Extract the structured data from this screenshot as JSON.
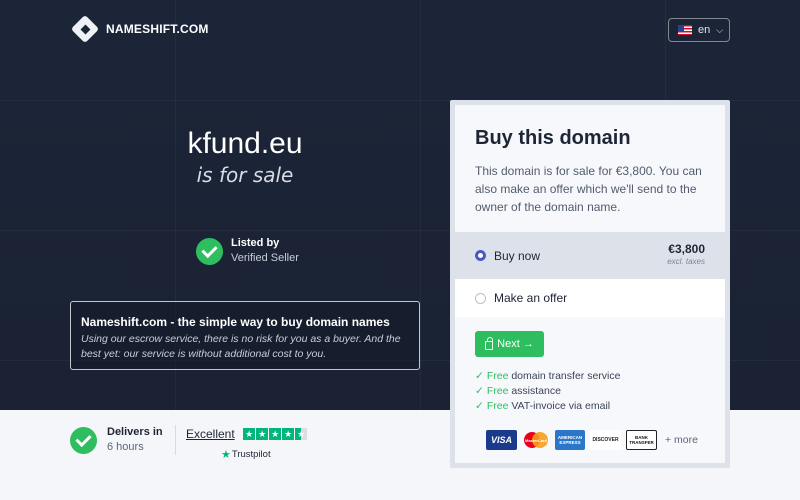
{
  "brand": {
    "name": "NAMESHIFT.COM"
  },
  "language": {
    "code": "en",
    "flag_icon": "us-flag-icon"
  },
  "hero": {
    "domain": "kfund.eu",
    "tagline": "is for sale",
    "seller_label": "Listed by",
    "seller_value": "Verified Seller"
  },
  "info": {
    "title": "Nameshift.com - the simple way to buy domain names",
    "body": "Using our escrow service, there is no risk for you as a buyer. And the best yet: our service is without additional cost to you."
  },
  "delivery": {
    "label": "Delivers in",
    "value": "6 hours"
  },
  "trustpilot": {
    "rating_label": "Excellent",
    "stars": 4.5,
    "brand": "Trustpilot"
  },
  "card": {
    "title": "Buy this domain",
    "description": "This domain is for sale for €3,800. You can also make an offer which we'll send to the owner of the domain name.",
    "options": {
      "buy_now": {
        "label": "Buy now",
        "price": "€3,800",
        "note": "excl. taxes",
        "selected": true
      },
      "offer": {
        "label": "Make an offer",
        "selected": false
      }
    },
    "next_label": "Next →",
    "features": [
      {
        "free": "Free",
        "text": "domain transfer service"
      },
      {
        "free": "Free",
        "text": "assistance"
      },
      {
        "free": "Free",
        "text": "VAT-invoice via email"
      }
    ],
    "payment_methods": {
      "visa": "VISA",
      "mastercard": "MasterCard",
      "amex": "AMERICAN EXPRESS",
      "discover": "DISCOVER",
      "bank": "BANK TRANSFER",
      "more": "+ more"
    }
  },
  "colors": {
    "hero_bg": "#1c2538",
    "accent_green": "#2fbe5f",
    "radio_blue": "#4b56c9",
    "trustpilot_green": "#00b67a"
  }
}
